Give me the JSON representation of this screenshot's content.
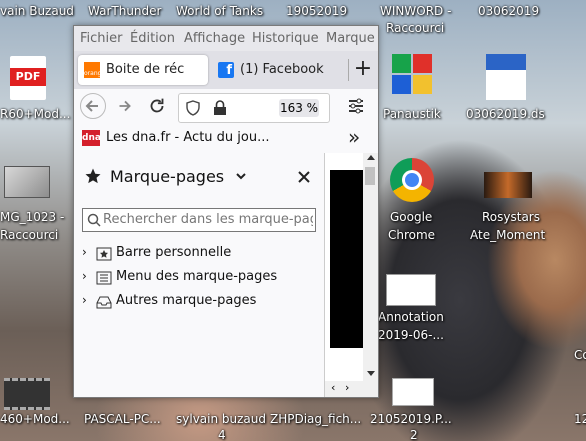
{
  "desktop": {
    "top_labels": [
      "vain Buzaud",
      "WarThunder",
      "World of Tanks",
      "19052019",
      "WINWORD -",
      "03062019"
    ],
    "top_label_sub": "Raccourci",
    "left_icons": [
      {
        "label": "R60+Mod...",
        "icon": "pdf-icon",
        "badge": "PDF"
      },
      {
        "label": "MG_1023 -",
        "sub": "Raccourci",
        "icon": "image-shortcut-icon"
      },
      {
        "label": "460+Mod...",
        "icon": "video-icon"
      }
    ],
    "right_icons": [
      {
        "label": "Panaustik",
        "icon": "tiles-app-icon"
      },
      {
        "label": "03062019.ds",
        "icon": "document-icon"
      },
      {
        "label": "Google",
        "sub": "Chrome",
        "icon": "chrome-icon"
      },
      {
        "label": "Rosystars",
        "sub": "Ate_Moment",
        "icon": "image-icon"
      },
      {
        "label": "Annotation",
        "sub": "2019-06-...",
        "icon": "screenshot-icon"
      }
    ],
    "bottom_labels": [
      "PASCAL-PC...",
      "sylvain buzaud",
      "ZHPDiag_fich...",
      "21052019.P..."
    ],
    "bottom_subs": [
      "4",
      "2"
    ],
    "edge_right": [
      "Co",
      "12"
    ]
  },
  "browser": {
    "menu": [
      "Fichier",
      "Édition",
      "Affichage",
      "Historique",
      "Marque"
    ],
    "tabs": [
      {
        "label": "Boite de réc",
        "icon": "orange-favicon-icon",
        "favicon_text": "orange"
      },
      {
        "label": "(1) Facebook",
        "icon": "facebook-icon"
      }
    ],
    "new_tab": "+",
    "zoom": "163 %",
    "bookmark": {
      "favicon": "dna",
      "label": "Les dna.fr - Actu du jou..."
    },
    "overflow": "»",
    "sidebar": {
      "title": "Marque-pages",
      "search_placeholder": "Rechercher dans les marque-pag",
      "items": [
        "Barre personnelle",
        "Menu des marque-pages",
        "Autres marque-pages"
      ]
    }
  }
}
